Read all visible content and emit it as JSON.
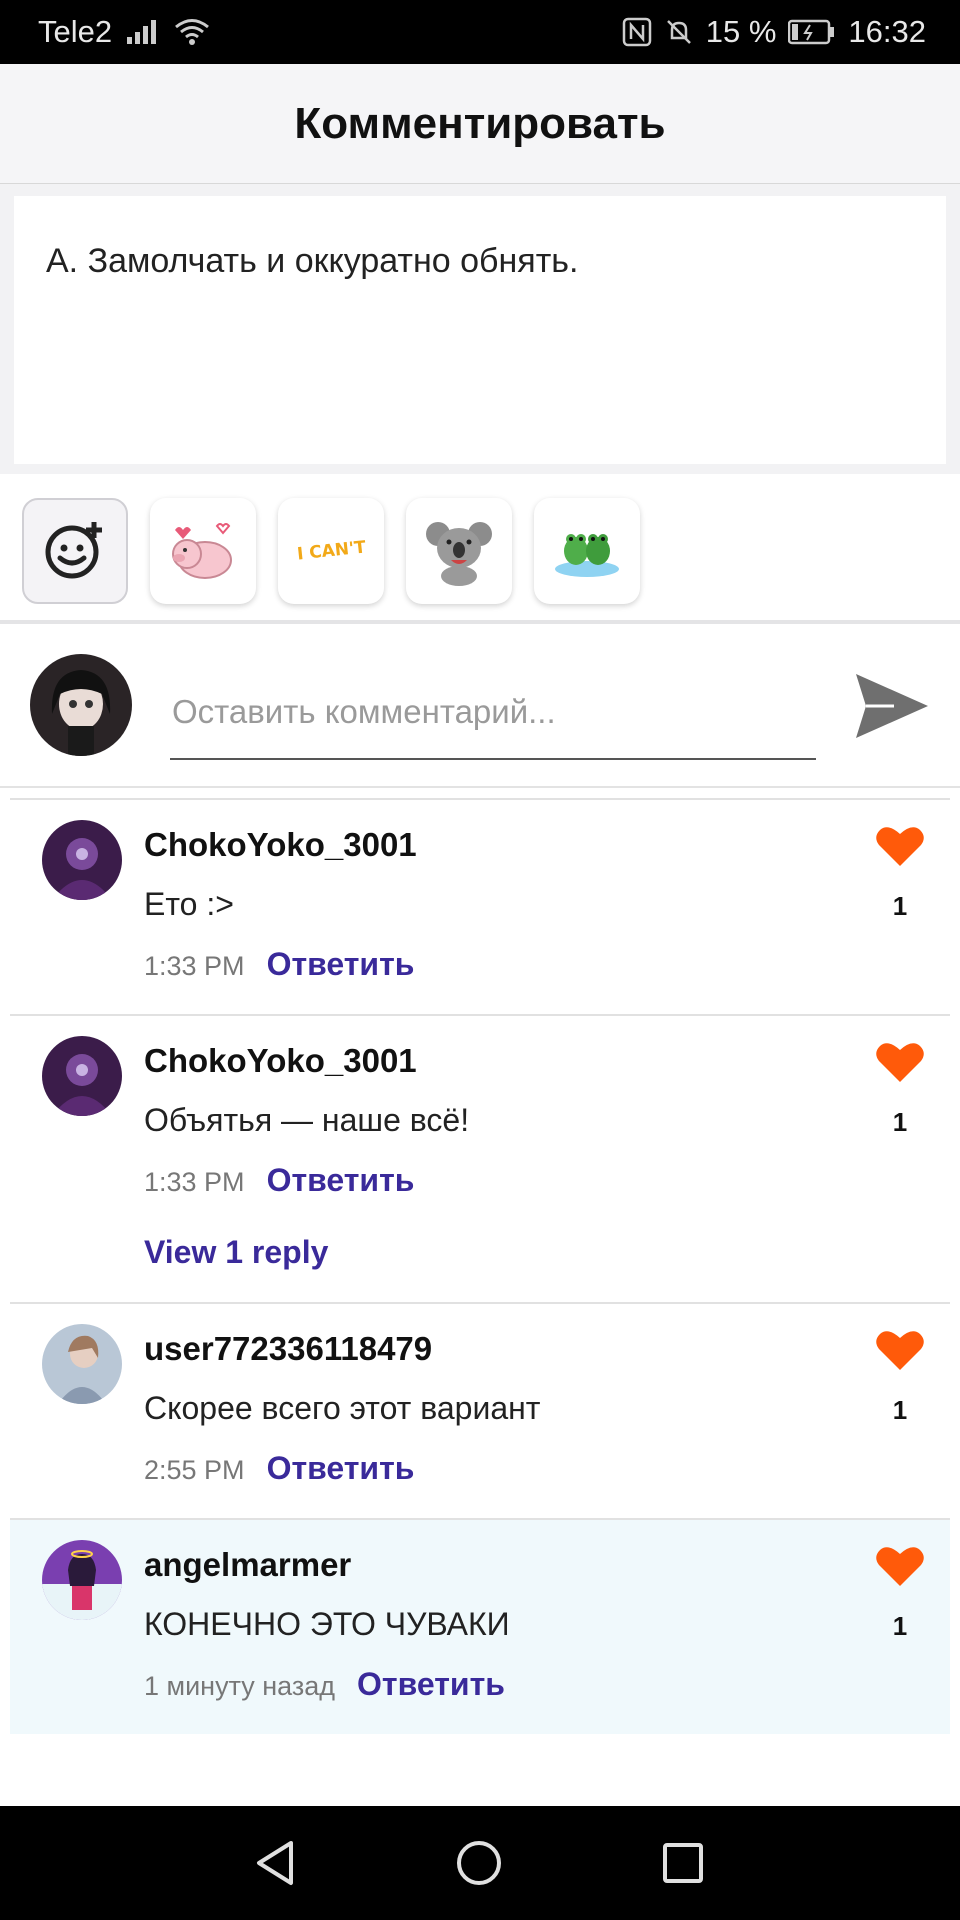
{
  "status_bar": {
    "carrier": "Tele2",
    "battery": "15 %",
    "time": "16:32",
    "icons": [
      "signal-icon",
      "wifi-icon",
      "nfc-icon",
      "mute-icon",
      "battery-icon"
    ]
  },
  "header": {
    "title": "Комментировать"
  },
  "quote": {
    "text": "А. Замолчать и оккуратно обнять."
  },
  "stickers": {
    "items": [
      "add-sticker-icon",
      "pig-sticker",
      "i-cant-sticker",
      "koala-sticker",
      "frog-sticker"
    ],
    "i_cant_text": "I CAN'T"
  },
  "input": {
    "placeholder": "Оставить комментарий...",
    "value": ""
  },
  "colors": {
    "accent": "#3a2a9a",
    "heart": "#ff5a0a",
    "highlight": "#f0f9fc"
  },
  "comments": [
    {
      "user": "ChokoYoko_3001",
      "text": "Ето :>",
      "time": "1:33 PM",
      "reply_label": "Ответить",
      "likes": "1",
      "view_replies": ""
    },
    {
      "user": "ChokoYoko_3001",
      "text": "Объятья — наше всё!",
      "time": "1:33 PM",
      "reply_label": "Ответить",
      "likes": "1",
      "view_replies": "View 1 reply"
    },
    {
      "user": "user772336118479",
      "text": "Скорее всего этот вариант",
      "time": "2:55 PM",
      "reply_label": "Ответить",
      "likes": "1",
      "view_replies": ""
    },
    {
      "user": "angelmarmer",
      "text": "КОНЕЧНО ЭТО ЧУВАКИ",
      "time": "1 минуту назад",
      "reply_label": "Ответить",
      "likes": "1",
      "view_replies": ""
    }
  ]
}
